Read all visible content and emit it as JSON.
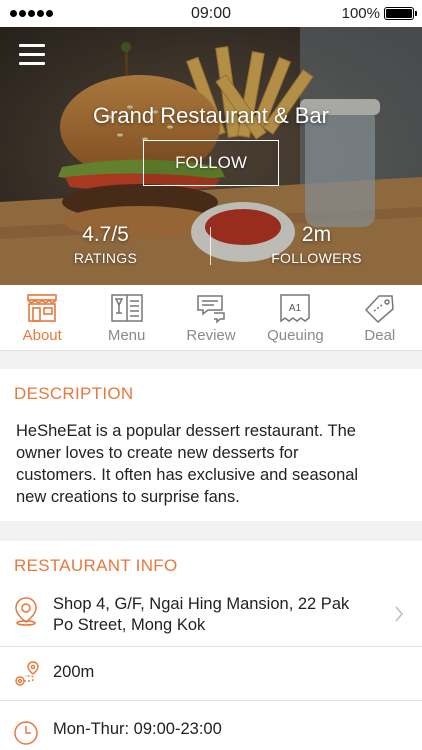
{
  "status_bar": {
    "time": "09:00",
    "battery": "100%"
  },
  "hero": {
    "title": "Grand Restaurant & Bar",
    "follow_label": "FOLLOW",
    "ratings_value": "4.7/5",
    "ratings_label": "RATINGS",
    "followers_value": "2m",
    "followers_label": "FOLLOWERS"
  },
  "tabs": [
    {
      "label": "About",
      "icon": "storefront-icon",
      "active": true
    },
    {
      "label": "Menu",
      "icon": "menu-book-icon"
    },
    {
      "label": "Review",
      "icon": "chat-bubbles-icon"
    },
    {
      "label": "Queuing",
      "icon": "queue-ticket-icon",
      "icon_text": "A1"
    },
    {
      "label": "Deal",
      "icon": "price-tag-icon"
    }
  ],
  "description": {
    "title": "DESCRIPTION",
    "lines": [
      "HeSheEat is a popular dessert restaurant. The",
      "owner loves to create new desserts for",
      "customers. It often has exclusive and seasonal",
      "new creations to surprise fans."
    ]
  },
  "restaurant_info": {
    "title": "RESTAURANT INFO",
    "address_lines": [
      "Shop 4, G/F, Ngai Hing Mansion, 22 Pak",
      "Po Street, Mong Kok"
    ],
    "distance": "200m",
    "hours_line": "Mon-Thur: 09:00-23:00"
  },
  "colors": {
    "accent": "#e8783c",
    "background": "#f2f2f2"
  }
}
